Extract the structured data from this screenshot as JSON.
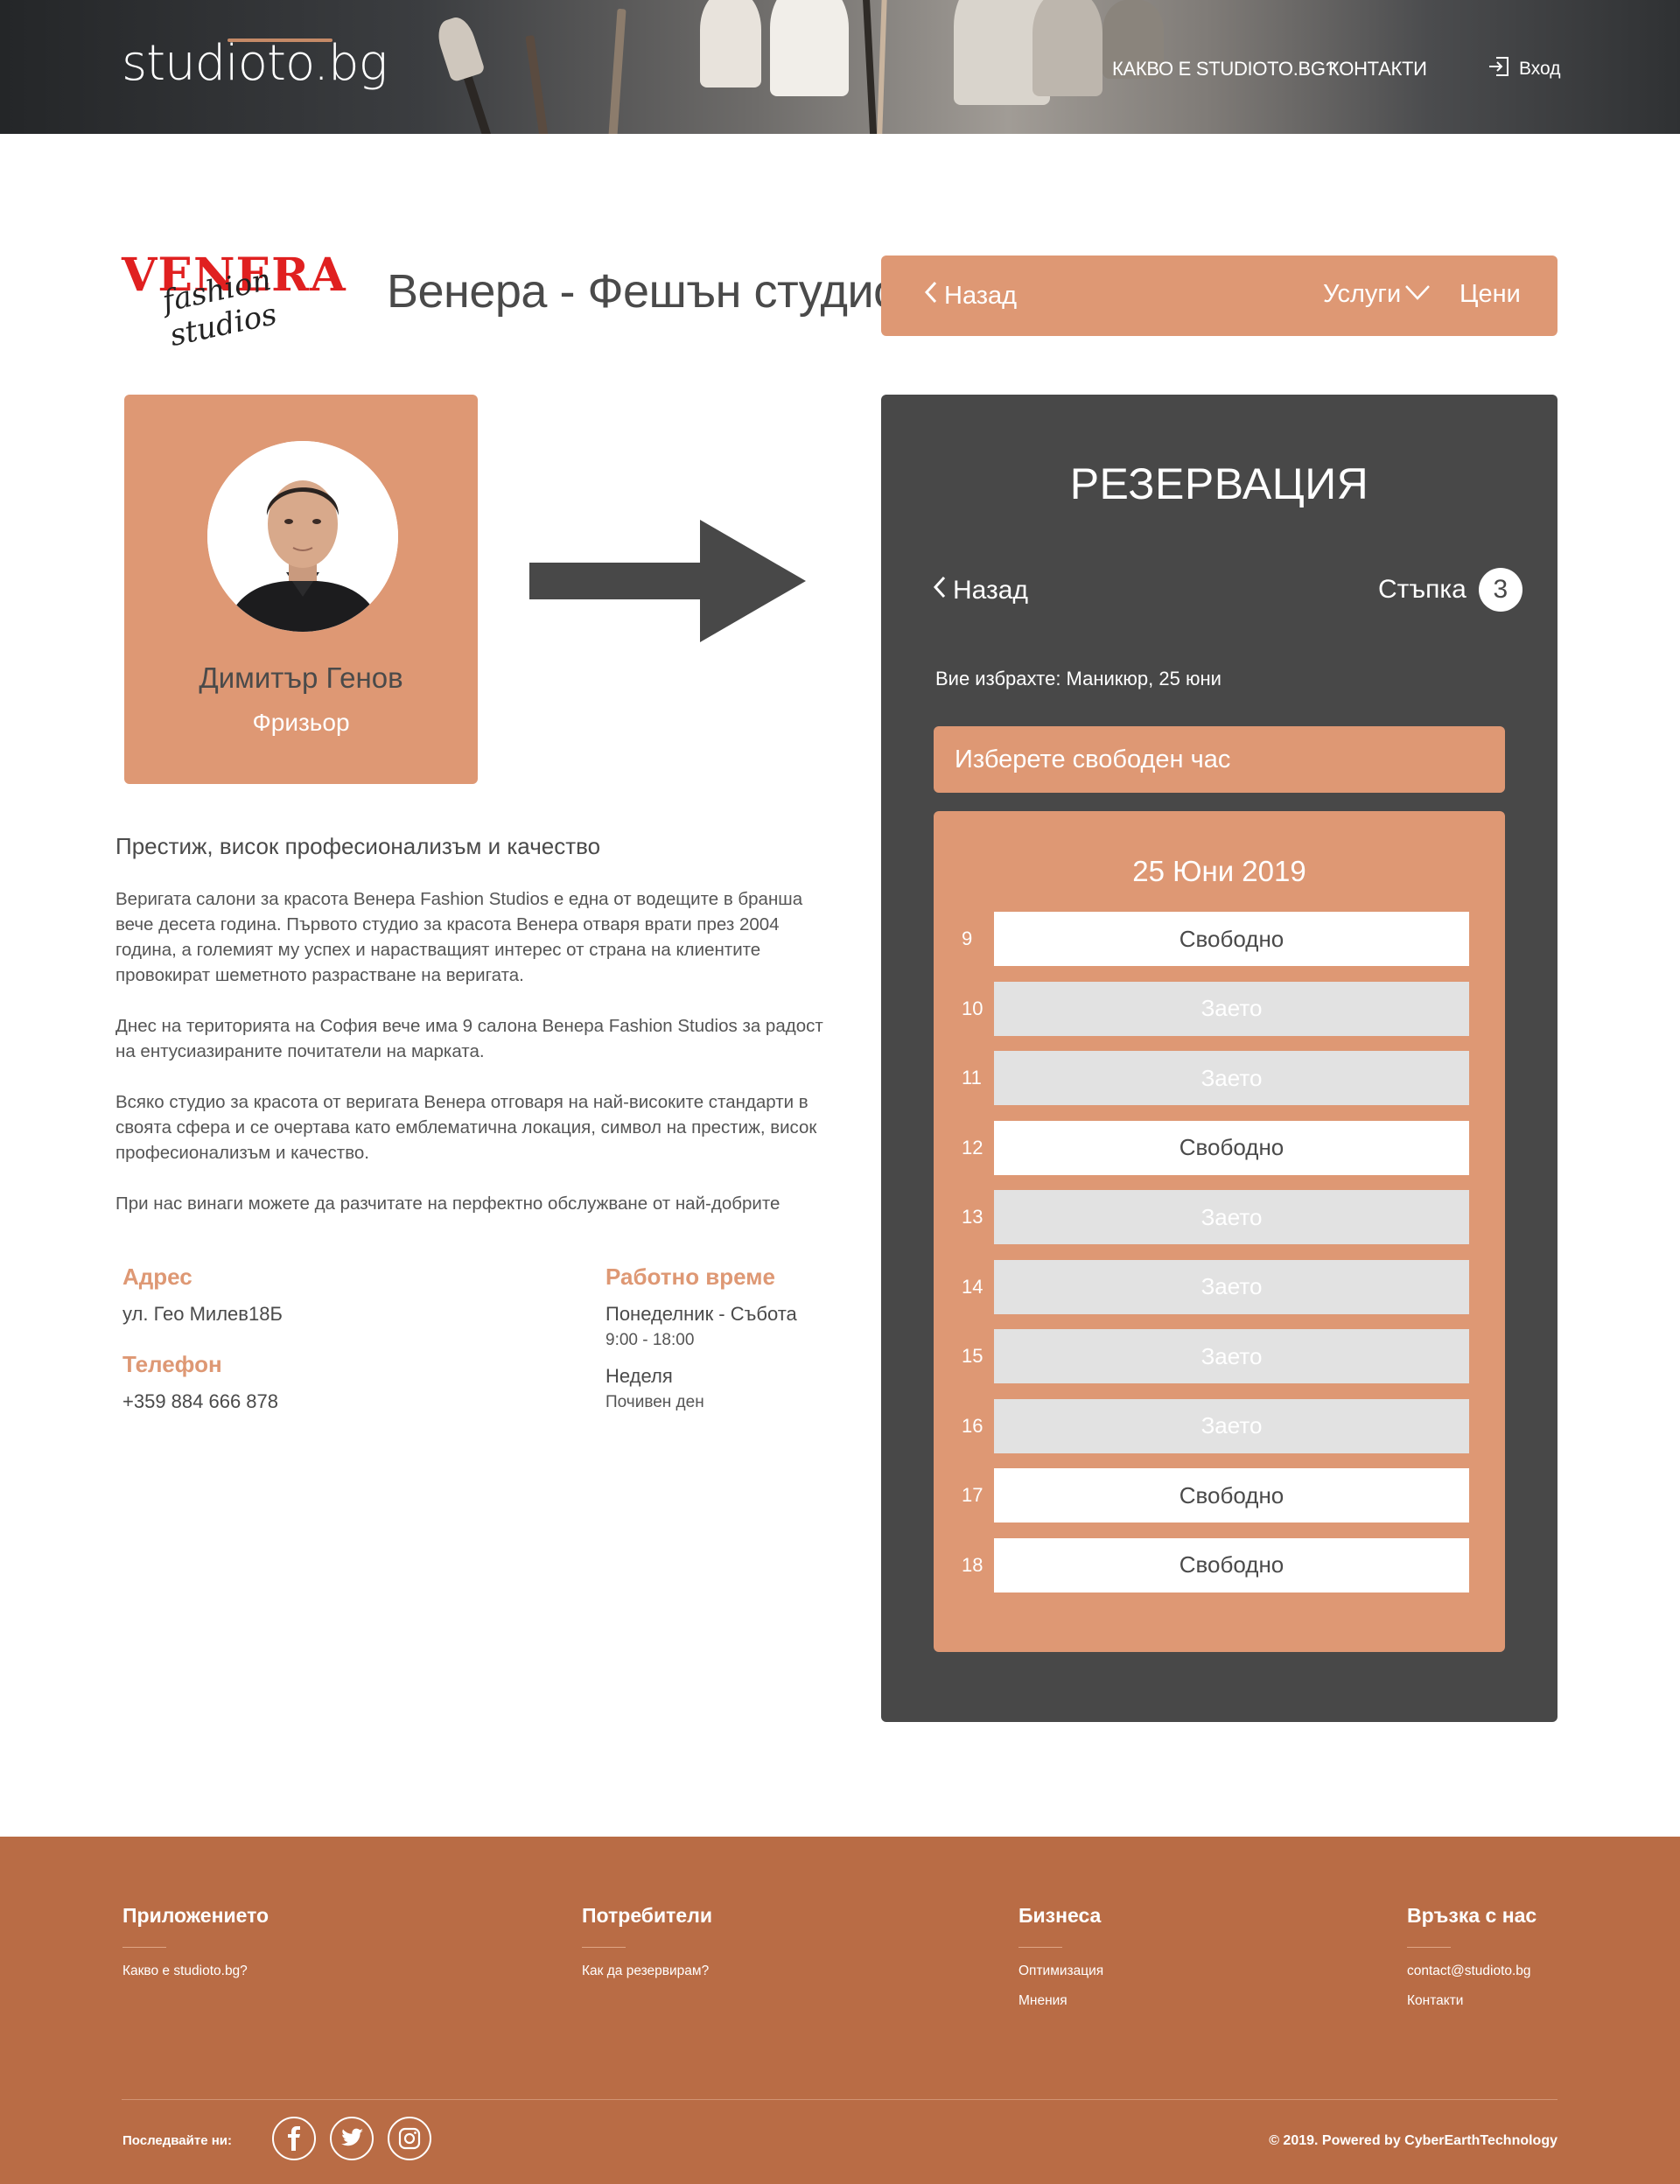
{
  "header": {
    "logo": "studioto.bg",
    "nav": [
      "КАКВО Е STUDIOTO.BG?",
      "КОНТАКТИ"
    ],
    "login_label": "Вход"
  },
  "studio": {
    "logo_word": "VENERA",
    "logo_script": "fashion studios",
    "title": "Венера - Фешън студио",
    "topbar": {
      "back_label": "Назад",
      "services_label": "Услуги",
      "prices_label": "Цени"
    }
  },
  "profile": {
    "name": "Димитър Генов",
    "role": "Фризьор"
  },
  "about": {
    "title": "Престиж, висок професионализъм и качество",
    "paragraphs": [
      "Веригата салони за красота Венера Fashion Studios е една от водещите в бранша вече десета година. Първото студио за красота Венера отваря врати през 2004 година, а големият му успех и нарастващият интерес от страна на клиентите провокират шеметното разрастване на веригата.",
      "Днес на територията на София вече има 9 салона Венера Fashion Studios за радост на ентусиазираните почитатели на марката.",
      "Всяко студио за красота от веригата Венера отговаря на най-високите стандарти в своята сфера и се очертава като емблематична локация, символ на престиж, висок професионализъм и качество.",
      "При нас винаги можете да разчитате на перфектно обслужване от най-добрите"
    ]
  },
  "info": {
    "address_label": "Адрес",
    "address": "ул. Гео Милев18Б",
    "phone_label": "Телефон",
    "phone": "+359 884 666 878",
    "hours_label": "Работно време",
    "weekdays_label": "Понеделник - Събота",
    "weekdays_hours": "9:00 - 18:00",
    "sunday_label": "Неделя",
    "sunday_hours": "Почивен ден"
  },
  "reservation": {
    "title": "РЕЗЕРВАЦИЯ",
    "back_label": "Назад",
    "step_label": "Стъпка",
    "step_number": "3",
    "selected_text": "Вие избрахте: Маникюр, 25 юни",
    "choose_label": "Изберете свободен час",
    "date": "25 Юни 2019",
    "slots": [
      {
        "hour": "9",
        "status": "Свободно",
        "free": true
      },
      {
        "hour": "10",
        "status": "Заето",
        "free": false
      },
      {
        "hour": "11",
        "status": "Заето",
        "free": false
      },
      {
        "hour": "12",
        "status": "Свободно",
        "free": true
      },
      {
        "hour": "13",
        "status": "Заето",
        "free": false
      },
      {
        "hour": "14",
        "status": "Заето",
        "free": false
      },
      {
        "hour": "15",
        "status": "Заето",
        "free": false
      },
      {
        "hour": "16",
        "status": "Заето",
        "free": false
      },
      {
        "hour": "17",
        "status": "Свободно",
        "free": true
      },
      {
        "hour": "18",
        "status": "Свободно",
        "free": true
      }
    ]
  },
  "footer": {
    "columns": [
      {
        "title": "Приложението",
        "links": [
          "Какво е studioto.bg?"
        ]
      },
      {
        "title": "Потребители",
        "links": [
          "Как да резервирам?"
        ]
      },
      {
        "title": "Бизнеса",
        "links": [
          "Оптимизация",
          "Мнения"
        ]
      },
      {
        "title": "Връзка с нас",
        "links": [
          "contact@studioto.bg",
          "Контакти"
        ]
      }
    ],
    "follow_label": "Последвайте ни:",
    "social_icons": [
      "facebook-icon",
      "twitter-icon",
      "instagram-icon"
    ],
    "copyright": "© 2019. Powered by CyberEarthTechnology"
  },
  "colors": {
    "accent": "#de9874",
    "panel": "#484848",
    "footer": "#b96c45",
    "slot_busy": "#e2e2e2"
  }
}
